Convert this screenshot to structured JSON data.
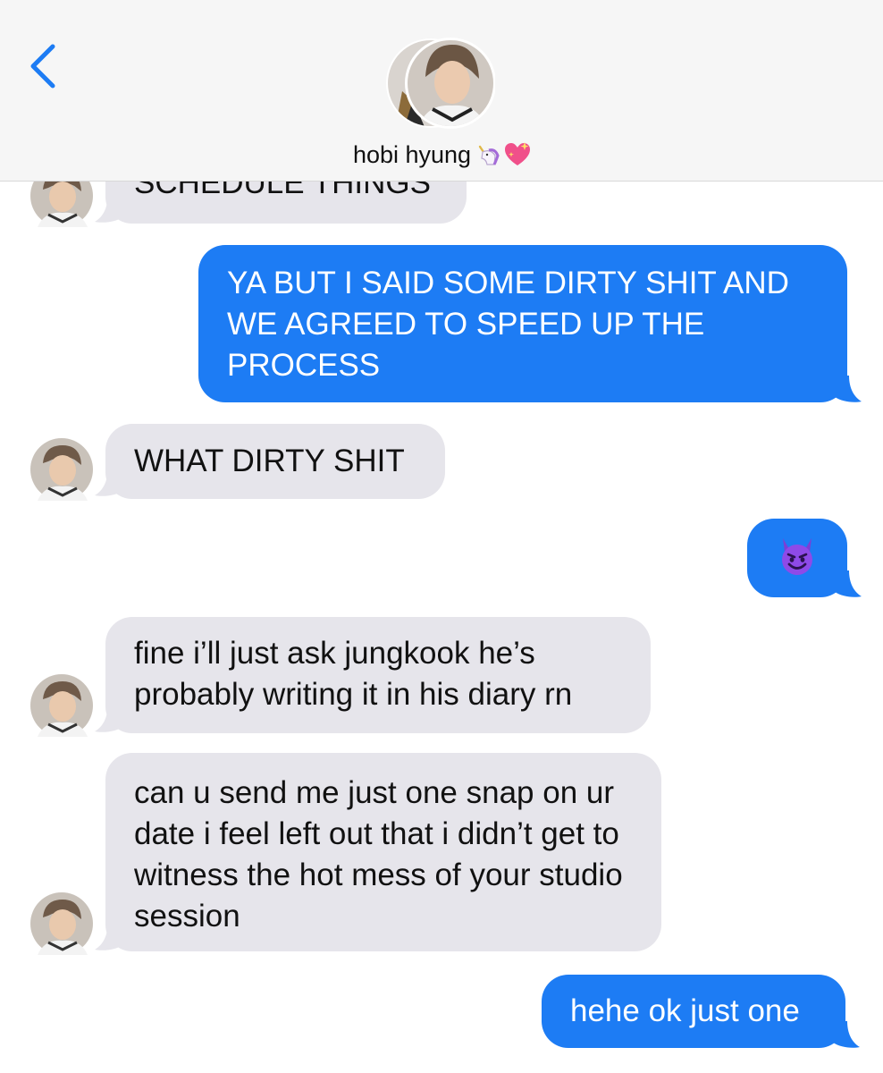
{
  "header": {
    "contact_name": "hobi hyung",
    "name_emojis": [
      "unicorn-icon",
      "sparkling-heart-icon"
    ],
    "back_icon": "chevron-left-icon",
    "accent_color": "#1d7cf4"
  },
  "messages": [
    {
      "from": "them",
      "text": "SCHEDULE THINGS"
    },
    {
      "from": "me",
      "text": "YA BUT I SAID SOME DIRTY SHIT AND WE AGREED TO SPEED UP THE PROCESS"
    },
    {
      "from": "them",
      "text": "WHAT DIRTY SHIT"
    },
    {
      "from": "me",
      "emoji": "smiling-devil-icon"
    },
    {
      "from": "them",
      "text": "fine i’ll just ask jungkook he’s probably writing it in his diary rn"
    },
    {
      "from": "them",
      "text": "can u send me just one snap on ur date i feel left out that i didn’t get to witness the hot mess of your studio session"
    },
    {
      "from": "me",
      "text": "hehe ok just one"
    }
  ],
  "colors": {
    "incoming_bubble": "#e6e5eb",
    "outgoing_bubble": "#1d7cf4",
    "header_bg": "#f6f6f6"
  }
}
